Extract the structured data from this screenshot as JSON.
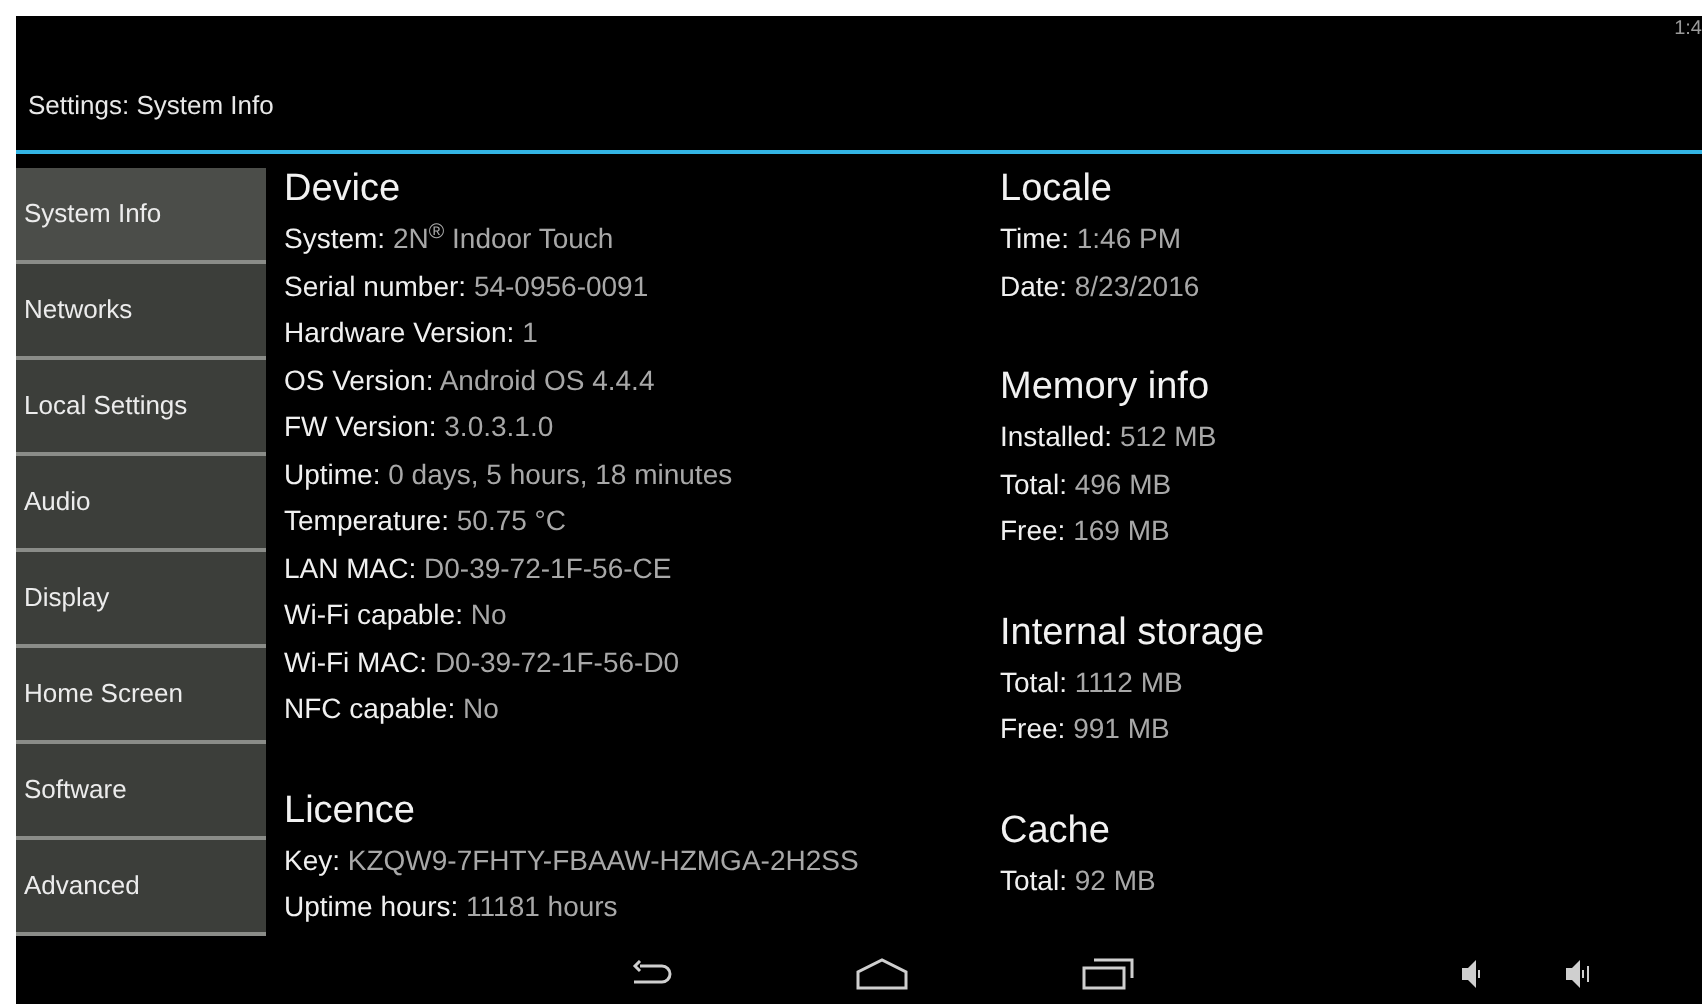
{
  "status_bar": {
    "clock": "1:4"
  },
  "title": "Settings: System Info",
  "sidebar": {
    "items": [
      {
        "label": "System Info",
        "selected": true
      },
      {
        "label": "Networks",
        "selected": false
      },
      {
        "label": "Local Settings",
        "selected": false
      },
      {
        "label": "Audio",
        "selected": false
      },
      {
        "label": "Display",
        "selected": false
      },
      {
        "label": "Home Screen",
        "selected": false
      },
      {
        "label": "Software",
        "selected": false
      },
      {
        "label": "Advanced",
        "selected": false
      }
    ]
  },
  "columns": [
    {
      "sections": [
        {
          "heading": "Device",
          "rows": [
            {
              "label": "System:",
              "value": "2N$^{®}$ Indoor Touch"
            },
            {
              "label": "Serial number:",
              "value": "54-0956-0091"
            },
            {
              "label": "Hardware Version:",
              "value": "1"
            },
            {
              "label": "OS Version:",
              "value": "Android OS 4.4.4"
            },
            {
              "label": "FW Version:",
              "value": "3.0.3.1.0"
            },
            {
              "label": "Uptime:",
              "value": "0 days, 5 hours, 18 minutes"
            },
            {
              "label": "Temperature:",
              "value": "50.75 °C"
            },
            {
              "label": "LAN MAC:",
              "value": "D0-39-72-1F-56-CE"
            },
            {
              "label": "Wi-Fi capable:",
              "value": "No"
            },
            {
              "label": "Wi-Fi MAC:",
              "value": "D0-39-72-1F-56-D0"
            },
            {
              "label": "NFC capable:",
              "value": "No"
            }
          ]
        },
        {
          "heading": "Licence",
          "rows": [
            {
              "label": "Key:",
              "value": "KZQW9-7FHTY-FBAAW-HZMGA-2H2SS"
            },
            {
              "label": "Uptime hours:",
              "value": "11181 hours"
            }
          ]
        }
      ]
    },
    {
      "sections": [
        {
          "heading": "Locale",
          "rows": [
            {
              "label": "Time:",
              "value": "1:46 PM"
            },
            {
              "label": "Date:",
              "value": "8/23/2016"
            }
          ]
        },
        {
          "heading": "Memory info",
          "rows": [
            {
              "label": "Installed:",
              "value": "512 MB"
            },
            {
              "label": "Total:",
              "value": "496 MB"
            },
            {
              "label": "Free:",
              "value": "169 MB"
            }
          ]
        },
        {
          "heading": "Internal storage",
          "rows": [
            {
              "label": "Total:",
              "value": "1112 MB"
            },
            {
              "label": "Free:",
              "value": "991 MB"
            }
          ]
        },
        {
          "heading": "Cache",
          "rows": [
            {
              "label": "Total:",
              "value": "92 MB"
            }
          ]
        }
      ]
    }
  ]
}
